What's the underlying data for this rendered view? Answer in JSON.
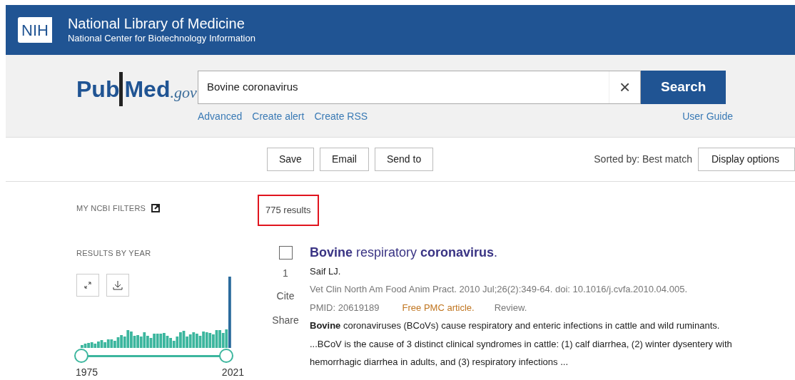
{
  "header": {
    "logo": "NIH",
    "title": "National Library of Medicine",
    "subtitle": "National Center for Biotechnology Information"
  },
  "search": {
    "logo_main": "Pub",
    "logo_m": "Med",
    "logo_suffix": ".gov",
    "value": "Bovine coronavirus",
    "clear": "×",
    "button": "Search",
    "links": [
      "Advanced",
      "Create alert",
      "Create RSS"
    ],
    "guide": "User Guide"
  },
  "toolbar": {
    "buttons": [
      "Save",
      "Email",
      "Send to"
    ],
    "sort": "Sorted by: Best match",
    "display": "Display options"
  },
  "sidebar": {
    "filters": "MY NCBI FILTERS",
    "by_year": "RESULTS BY YEAR",
    "year_start": "1975",
    "year_end": "2021"
  },
  "results": {
    "count": "775 results",
    "count_highlighted": true,
    "items": [
      {
        "checked": false,
        "number": "1",
        "cite": "Cite",
        "share": "Share",
        "title": "**Bovine** respiratory **coronavirus**.",
        "authors": "Saif LJ.",
        "citation": "Vet Clin North Am Food Anim Pract. 2010 Jul;26(2):349-64. doi: 10.1016/j.cvfa.2010.04.005.",
        "pmid": "PMID: 20619189",
        "free": "Free PMC article.",
        "type": "Review.",
        "snippet": [
          "**Bovine** coronaviruses (BCoVs) cause respiratory and enteric infections in cattle and wild ruminants.",
          "...BCoV is the cause of 3 distinct clinical syndromes in cattle: (1) calf diarrhea, (2) winter dysentery with",
          "hemorrhagic diarrhea in adults, and (3) respiratory infections ..."
        ]
      }
    ]
  }
}
